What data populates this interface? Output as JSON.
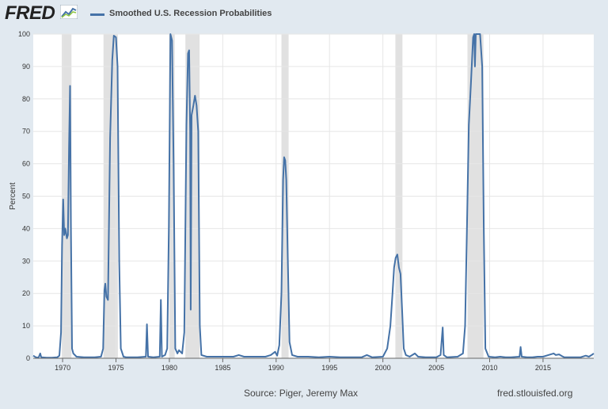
{
  "header": {
    "logo_text": "FRED",
    "logo_icon": "trend-chart-icon",
    "legend_label": "Smoothed U.S. Recession Probabilities"
  },
  "footer": {
    "source": "Source: Piger, Jeremy Max",
    "url": "fred.stlouisfed.org"
  },
  "colors": {
    "series": "#4572a7",
    "recession_band": "#e1e1e1",
    "plot_background": "#ffffff",
    "page_background": "#e1e9f0",
    "grid": "#e6e6e6"
  },
  "chart_data": {
    "type": "line",
    "title": "",
    "xlabel": "",
    "ylabel": "Percent",
    "xlim": [
      1967.25,
      2019.75
    ],
    "ylim": [
      0,
      100
    ],
    "x_ticks": [
      1970,
      1975,
      1980,
      1985,
      1990,
      1995,
      2000,
      2005,
      2010,
      2015
    ],
    "y_ticks": [
      0,
      10,
      20,
      30,
      40,
      50,
      60,
      70,
      80,
      90,
      100
    ],
    "grid": true,
    "legend_position": "top-left",
    "recession_bands": [
      [
        1969.92,
        1970.83
      ],
      [
        1973.83,
        1975.17
      ],
      [
        1980.0,
        1980.5
      ],
      [
        1981.5,
        1982.83
      ],
      [
        1990.5,
        1991.17
      ],
      [
        2001.17,
        2001.83
      ],
      [
        2007.92,
        2009.42
      ]
    ],
    "series": [
      {
        "name": "Smoothed U.S. Recession Probabilities",
        "points": [
          [
            1967.25,
            0.8
          ],
          [
            1967.5,
            0.3
          ],
          [
            1967.75,
            0.2
          ],
          [
            1967.9,
            1.5
          ],
          [
            1968.0,
            0.3
          ],
          [
            1968.5,
            0.2
          ],
          [
            1969.0,
            0.2
          ],
          [
            1969.5,
            0.3
          ],
          [
            1969.7,
            0.8
          ],
          [
            1969.85,
            8
          ],
          [
            1969.95,
            35
          ],
          [
            1970.05,
            49
          ],
          [
            1970.15,
            38
          ],
          [
            1970.25,
            40
          ],
          [
            1970.4,
            37
          ],
          [
            1970.5,
            38
          ],
          [
            1970.6,
            65
          ],
          [
            1970.7,
            84
          ],
          [
            1970.78,
            40
          ],
          [
            1970.88,
            3
          ],
          [
            1971.0,
            1.5
          ],
          [
            1971.3,
            0.5
          ],
          [
            1972.0,
            0.3
          ],
          [
            1973.0,
            0.3
          ],
          [
            1973.6,
            0.5
          ],
          [
            1973.8,
            3
          ],
          [
            1973.92,
            21
          ],
          [
            1974.0,
            23
          ],
          [
            1974.1,
            19
          ],
          [
            1974.25,
            18
          ],
          [
            1974.45,
            68
          ],
          [
            1974.65,
            92
          ],
          [
            1974.8,
            99.5
          ],
          [
            1975.0,
            99
          ],
          [
            1975.15,
            90
          ],
          [
            1975.3,
            30
          ],
          [
            1975.45,
            3
          ],
          [
            1975.7,
            0.5
          ],
          [
            1976.0,
            0.3
          ],
          [
            1977.0,
            0.3
          ],
          [
            1977.8,
            0.5
          ],
          [
            1977.9,
            10.5
          ],
          [
            1978.0,
            0.5
          ],
          [
            1978.5,
            0.3
          ],
          [
            1979.1,
            0.5
          ],
          [
            1979.2,
            18
          ],
          [
            1979.3,
            0.5
          ],
          [
            1979.6,
            1
          ],
          [
            1979.8,
            3
          ],
          [
            1979.95,
            40
          ],
          [
            1980.1,
            100
          ],
          [
            1980.25,
            98
          ],
          [
            1980.4,
            60
          ],
          [
            1980.55,
            3
          ],
          [
            1980.75,
            1.5
          ],
          [
            1980.9,
            2.5
          ],
          [
            1981.2,
            1.5
          ],
          [
            1981.4,
            8
          ],
          [
            1981.6,
            72
          ],
          [
            1981.75,
            94
          ],
          [
            1981.85,
            95
          ],
          [
            1981.95,
            70
          ],
          [
            1982.0,
            15
          ],
          [
            1982.08,
            75
          ],
          [
            1982.25,
            78
          ],
          [
            1982.4,
            81
          ],
          [
            1982.55,
            78
          ],
          [
            1982.7,
            70
          ],
          [
            1982.85,
            10
          ],
          [
            1983.0,
            1
          ],
          [
            1983.5,
            0.5
          ],
          [
            1984.0,
            0.5
          ],
          [
            1985.0,
            0.5
          ],
          [
            1986.0,
            0.5
          ],
          [
            1986.5,
            1
          ],
          [
            1987.0,
            0.5
          ],
          [
            1988.0,
            0.5
          ],
          [
            1989.0,
            0.5
          ],
          [
            1989.5,
            1
          ],
          [
            1989.9,
            2
          ],
          [
            1990.1,
            0.8
          ],
          [
            1990.3,
            4
          ],
          [
            1990.5,
            20
          ],
          [
            1990.65,
            55
          ],
          [
            1990.75,
            62
          ],
          [
            1990.85,
            61
          ],
          [
            1990.95,
            55
          ],
          [
            1991.1,
            30
          ],
          [
            1991.25,
            5
          ],
          [
            1991.5,
            1
          ],
          [
            1992.0,
            0.5
          ],
          [
            1993.0,
            0.5
          ],
          [
            1994.0,
            0.3
          ],
          [
            1995.0,
            0.5
          ],
          [
            1996.0,
            0.3
          ],
          [
            1997.0,
            0.3
          ],
          [
            1998.0,
            0.3
          ],
          [
            1998.5,
            1
          ],
          [
            1999.0,
            0.3
          ],
          [
            2000.0,
            0.5
          ],
          [
            2000.4,
            3
          ],
          [
            2000.7,
            10
          ],
          [
            2000.9,
            20
          ],
          [
            2001.05,
            28
          ],
          [
            2001.2,
            31
          ],
          [
            2001.35,
            32
          ],
          [
            2001.5,
            28
          ],
          [
            2001.65,
            26
          ],
          [
            2001.8,
            15
          ],
          [
            2001.95,
            3
          ],
          [
            2002.15,
            1
          ],
          [
            2002.5,
            0.5
          ],
          [
            2003.0,
            1.5
          ],
          [
            2003.3,
            0.5
          ],
          [
            2004.0,
            0.3
          ],
          [
            2005.0,
            0.3
          ],
          [
            2005.4,
            1
          ],
          [
            2005.6,
            9.5
          ],
          [
            2005.7,
            1
          ],
          [
            2006.0,
            0.3
          ],
          [
            2007.0,
            0.5
          ],
          [
            2007.5,
            1.5
          ],
          [
            2007.7,
            10
          ],
          [
            2007.9,
            45
          ],
          [
            2008.05,
            72
          ],
          [
            2008.25,
            85
          ],
          [
            2008.45,
            99
          ],
          [
            2008.55,
            100
          ],
          [
            2008.62,
            90
          ],
          [
            2008.7,
            100
          ],
          [
            2008.9,
            100
          ],
          [
            2009.1,
            100
          ],
          [
            2009.3,
            90
          ],
          [
            2009.45,
            40
          ],
          [
            2009.6,
            3
          ],
          [
            2009.9,
            0.5
          ],
          [
            2010.5,
            0.3
          ],
          [
            2011.0,
            0.5
          ],
          [
            2011.5,
            0.3
          ],
          [
            2012.0,
            0.3
          ],
          [
            2012.8,
            0.5
          ],
          [
            2012.9,
            3.5
          ],
          [
            2013.0,
            0.5
          ],
          [
            2013.5,
            0.3
          ],
          [
            2014.0,
            0.3
          ],
          [
            2014.5,
            0.5
          ],
          [
            2015.0,
            0.5
          ],
          [
            2015.5,
            1
          ],
          [
            2016.0,
            1.5
          ],
          [
            2016.2,
            1
          ],
          [
            2016.5,
            1.2
          ],
          [
            2016.8,
            0.6
          ],
          [
            2017.0,
            0.3
          ],
          [
            2017.5,
            0.3
          ],
          [
            2018.0,
            0.3
          ],
          [
            2018.5,
            0.3
          ],
          [
            2019.0,
            0.8
          ],
          [
            2019.3,
            0.5
          ],
          [
            2019.55,
            1
          ],
          [
            2019.75,
            1.5
          ]
        ]
      }
    ]
  }
}
